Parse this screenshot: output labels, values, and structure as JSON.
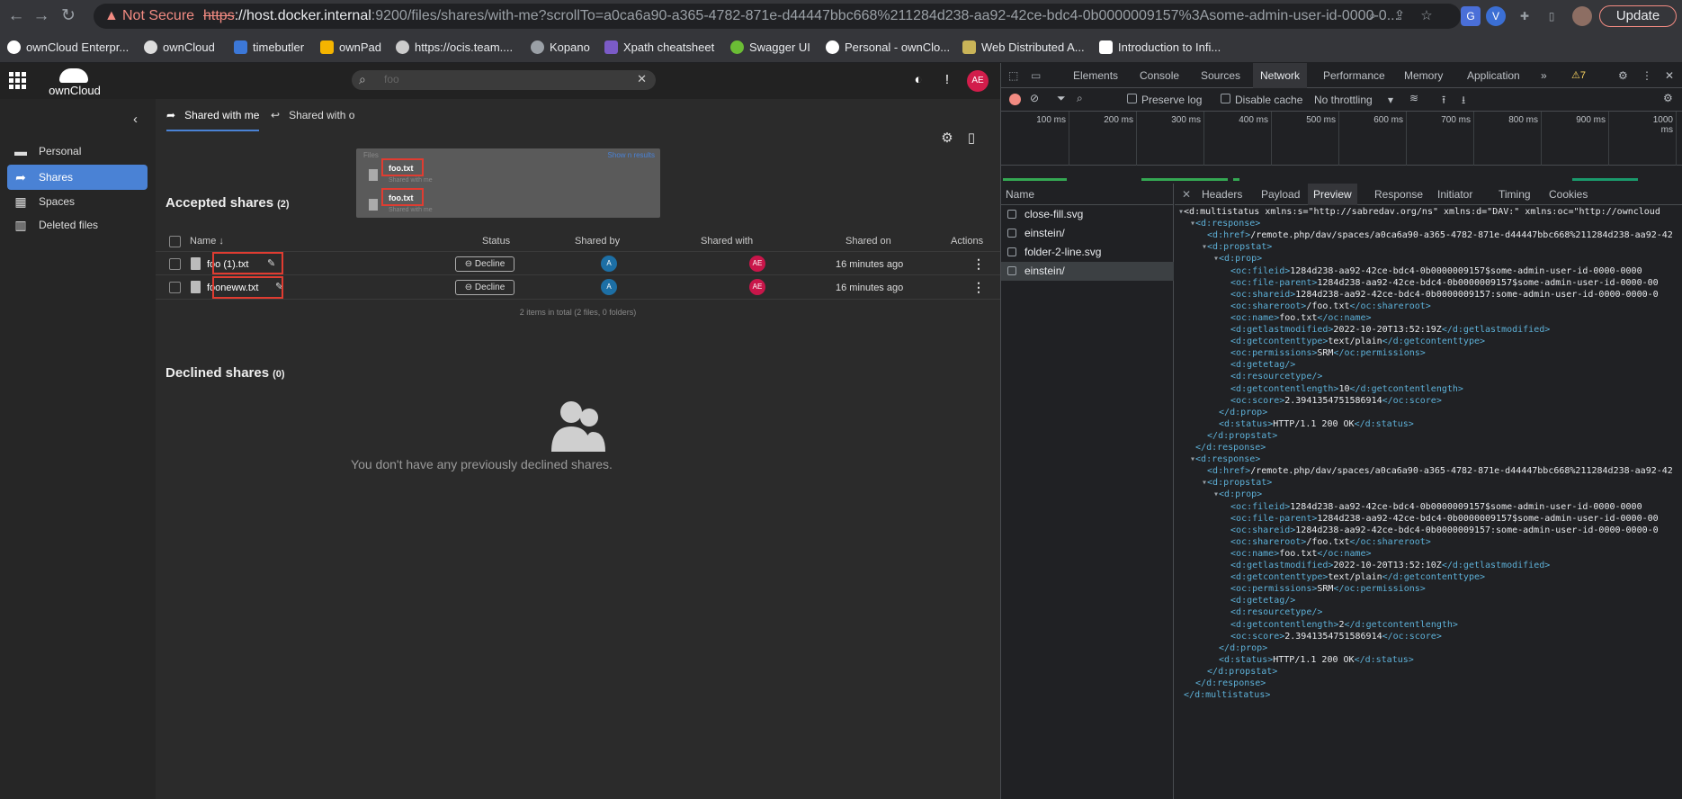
{
  "browser": {
    "not_secure": "Not Secure",
    "url_scheme": "https",
    "url_host": "://host.docker.internal",
    "url_path": ":9200/files/shares/with-me?scrollTo=a0ca6a90-a365-4782-871e-d44447bbc668%211284d238-aa92-42ce-bdc4-0b0000009157%3Asome-admin-user-id-0000-0...",
    "update_label": "Update",
    "profile_letter": "V",
    "bookmarks": [
      "ownCloud Enterpr...",
      "ownCloud",
      "timebutler",
      "ownPad",
      "https://ocis.team....",
      "Kopano",
      "Xpath cheatsheet",
      "Swagger UI",
      "Personal - ownClo...",
      "Web Distributed A...",
      "Introduction to Infi..."
    ]
  },
  "owncloud": {
    "logo_text": "ownCloud",
    "search_value": "foo",
    "avatar_initials": "AE",
    "sidebar": [
      {
        "label": "Personal",
        "icon": "folder-icon"
      },
      {
        "label": "Shares",
        "icon": "share-icon"
      },
      {
        "label": "Spaces",
        "icon": "grid-icon"
      },
      {
        "label": "Deleted files",
        "icon": "trash-icon"
      }
    ],
    "tabs": [
      "Shared with me",
      "Shared with o"
    ],
    "accepted_title": "Accepted shares",
    "accepted_count": "(2)",
    "columns": {
      "name": "Name",
      "status": "Status",
      "shared_by": "Shared by",
      "shared_with": "Shared with",
      "shared_on": "Shared on",
      "actions": "Actions"
    },
    "rows": [
      {
        "name": "foo (1).txt",
        "status": "Decline",
        "shared_by": "A",
        "shared_with": "AE",
        "shared_on": "16 minutes ago"
      },
      {
        "name": "fooneww.txt",
        "status": "Decline",
        "shared_by": "A",
        "shared_with": "AE",
        "shared_on": "16 minutes ago"
      }
    ],
    "footer_text": "2 items in total (2 files, 0 folders)",
    "declined_title": "Declined shares",
    "declined_count": "(0)",
    "declined_empty": "You don't have any previously declined shares.",
    "dropdown": {
      "label": "Files",
      "show_more": "Show n results",
      "items": [
        {
          "name": "foo.txt",
          "sub": "Shared with me"
        },
        {
          "name": "foo.txt",
          "sub": "Shared with me"
        }
      ]
    }
  },
  "devtools": {
    "tabs": [
      "Elements",
      "Console",
      "Sources",
      "Network",
      "Performance",
      "Memory",
      "Application"
    ],
    "warning_count": "7",
    "toolbar": {
      "preserve_log": "Preserve log",
      "disable_cache": "Disable cache",
      "throttling": "No throttling"
    },
    "timeline_ticks": [
      "100 ms",
      "200 ms",
      "300 ms",
      "400 ms",
      "500 ms",
      "600 ms",
      "700 ms",
      "800 ms",
      "900 ms",
      "1000 ms"
    ],
    "name_header": "Name",
    "requests": [
      "close-fill.svg",
      "einstein/",
      "folder-2-line.svg",
      "einstein/"
    ],
    "preview_tabs": [
      "Headers",
      "Payload",
      "Preview",
      "Response",
      "Initiator",
      "Timing",
      "Cookies"
    ],
    "xml_lines": [
      "<d:multistatus xmlns:s=\"http://sabredav.org/ns\" xmlns:d=\"DAV:\" xmlns:oc=\"http://owncloud",
      "<d:response>",
      "<d:href>/remote.php/dav/spaces/a0ca6a90-a365-4782-871e-d44447bbc668%211284d238-aa92-42",
      "<d:propstat>",
      "<d:prop>",
      "<oc:fileid>1284d238-aa92-42ce-bdc4-0b0000009157$some-admin-user-id-0000-0000",
      "<oc:file-parent>1284d238-aa92-42ce-bdc4-0b0000009157$some-admin-user-id-0000-00",
      "<oc:shareid>1284d238-aa92-42ce-bdc4-0b0000009157:some-admin-user-id-0000-0000-0",
      "<oc:shareroot>/foo.txt</oc:shareroot>",
      "<oc:name>foo.txt</oc:name>",
      "<d:getlastmodified>2022-10-20T13:52:19Z</d:getlastmodified>",
      "<d:getcontenttype>text/plain</d:getcontenttype>",
      "<oc:permissions>SRM</oc:permissions>",
      "<d:getetag/>",
      "<d:resourcetype/>",
      "<d:getcontentlength>10</d:getcontentlength>",
      "<oc:score>2.3941354751586914</oc:score>",
      "</d:prop>",
      "<d:status>HTTP/1.1 200 OK</d:status>",
      "</d:propstat>",
      "</d:response>",
      "<d:response>",
      "<d:href>/remote.php/dav/spaces/a0ca6a90-a365-4782-871e-d44447bbc668%211284d238-aa92-42",
      "<d:propstat>",
      "<d:prop>",
      "<oc:fileid>1284d238-aa92-42ce-bdc4-0b0000009157$some-admin-user-id-0000-0000",
      "<oc:file-parent>1284d238-aa92-42ce-bdc4-0b0000009157$some-admin-user-id-0000-00",
      "<oc:shareid>1284d238-aa92-42ce-bdc4-0b0000009157:some-admin-user-id-0000-0000-0",
      "<oc:shareroot>/foo.txt</oc:shareroot>",
      "<oc:name>foo.txt</oc:name>",
      "<d:getlastmodified>2022-10-20T13:52:10Z</d:getlastmodified>",
      "<d:getcontenttype>text/plain</d:getcontenttype>",
      "<oc:permissions>SRM</oc:permissions>",
      "<d:getetag/>",
      "<d:resourcetype/>",
      "<d:getcontentlength>2</d:getcontentlength>",
      "<oc:score>2.3941354751586914</oc:score>",
      "</d:prop>",
      "<d:status>HTTP/1.1 200 OK</d:status>",
      "</d:propstat>",
      "</d:response>",
      "</d:multistatus>"
    ]
  }
}
